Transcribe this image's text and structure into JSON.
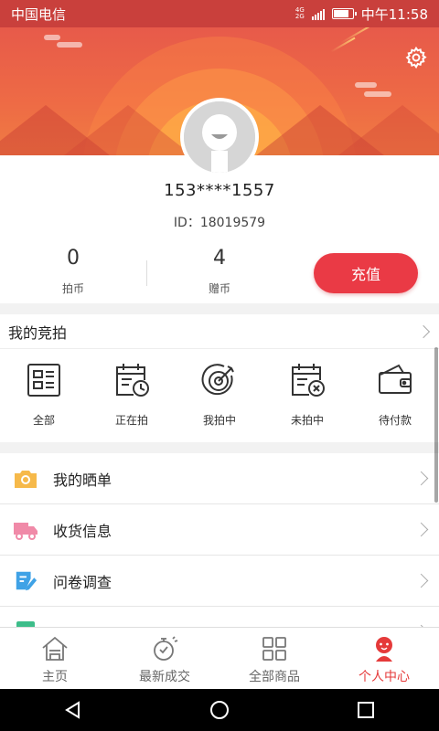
{
  "status_bar": {
    "carrier": "中国电信",
    "network": "4G",
    "network2": "2G",
    "time": "中午11:58",
    "battery_level": 0.8
  },
  "header": {
    "settings_icon": "gear-icon",
    "avatar_icon": "default-avatar-icon"
  },
  "profile": {
    "phone": "153****1557",
    "id_text": "ID：18019579",
    "stats": [
      {
        "value": "0",
        "label": "拍币"
      },
      {
        "value": "4",
        "label": "赠币"
      }
    ],
    "recharge_label": "充值"
  },
  "colors": {
    "accent": "#ea3a45",
    "banner": "#ee6b45"
  },
  "auction": {
    "title": "我的竞拍",
    "items": [
      {
        "label": "全部",
        "icon": "list-doc-icon"
      },
      {
        "label": "正在拍",
        "icon": "calendar-clock-icon"
      },
      {
        "label": "我拍中",
        "icon": "target-icon"
      },
      {
        "label": "未拍中",
        "icon": "calendar-x-icon"
      },
      {
        "label": "待付款",
        "icon": "wallet-icon"
      }
    ]
  },
  "menu": [
    {
      "label": "我的晒单",
      "icon": "camera-icon",
      "color": "#f6b94a"
    },
    {
      "label": "收货信息",
      "icon": "truck-icon",
      "color": "#f08aa8"
    },
    {
      "label": "问卷调查",
      "icon": "survey-pen-icon",
      "color": "#3fa2e6"
    },
    {
      "label": "",
      "icon": "partial-row-icon",
      "color": "#3dbd8a"
    }
  ],
  "tabbar": [
    {
      "label": "主页",
      "icon": "home-icon",
      "active": false
    },
    {
      "label": "最新成交",
      "icon": "stopwatch-icon",
      "active": false
    },
    {
      "label": "全部商品",
      "icon": "grid-icon",
      "active": false
    },
    {
      "label": "个人中心",
      "icon": "person-icon",
      "active": true
    }
  ],
  "navbar": {
    "icons": [
      "back-icon",
      "home-circle-icon",
      "recents-icon"
    ]
  }
}
